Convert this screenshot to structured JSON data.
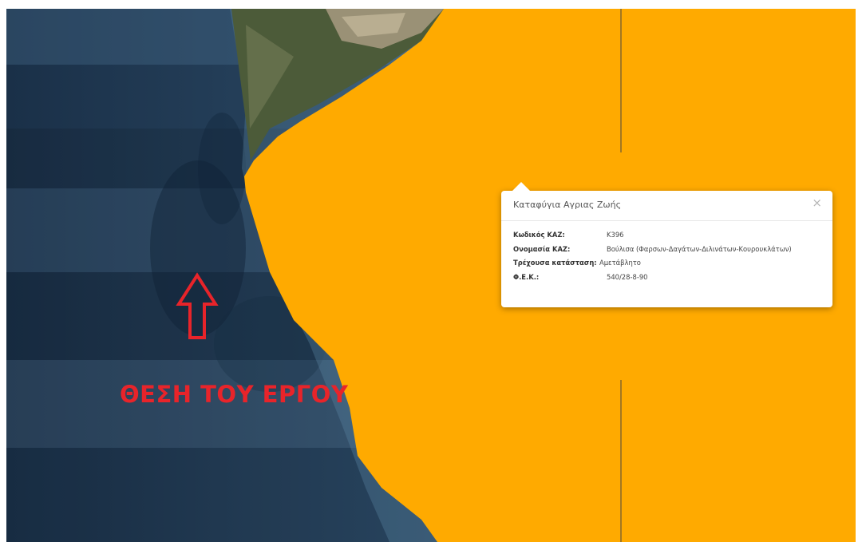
{
  "popup": {
    "title": "Καταφύγια Αγριας Ζωής",
    "close_label": "×",
    "rows": [
      {
        "label": "Κωδικός ΚΑΖ:",
        "value": "Κ396"
      },
      {
        "label": "Ονομασία ΚΑΖ:",
        "value": "Βούλισα (Φαρσων-Δαγάτων-Διλινάτων-Κουρουκλάτων)"
      },
      {
        "label": "Τρέχουσα κατάσταση:",
        "value": "Αμετάβλητο"
      },
      {
        "label": "Φ.Ε.Κ.:",
        "value": "540/28-8-90"
      }
    ]
  },
  "annotation": {
    "caption": "ΘΕΣΗ ΤΟΥ ΕΡΓΟΥ",
    "arrow_icon": "up-arrow-outline-icon",
    "color": "#e8242a"
  },
  "map": {
    "zone_color": "#ffaa00",
    "sea_color": "#1e3550",
    "land_color": "#4a5a3a"
  }
}
